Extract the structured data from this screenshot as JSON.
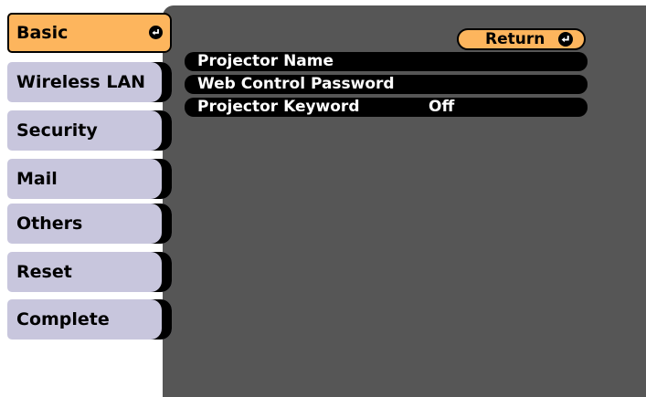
{
  "sidebar": {
    "items": [
      {
        "label": "Basic"
      },
      {
        "label": "Wireless LAN"
      },
      {
        "label": "Security"
      },
      {
        "label": "Mail"
      },
      {
        "label": "Others"
      },
      {
        "label": "Reset"
      },
      {
        "label": "Complete"
      }
    ],
    "active_index": 0,
    "active_icon": "enter-icon"
  },
  "main": {
    "return_label": "Return",
    "return_icon": "enter-icon",
    "rows": [
      {
        "label": "Projector Name",
        "value": ""
      },
      {
        "label": "Web Control Password",
        "value": ""
      },
      {
        "label": "Projector Keyword",
        "value": "Off"
      }
    ]
  },
  "colors": {
    "panel": "#565656",
    "tab": "#c8c6dd",
    "active": "#fdb55d",
    "row": "#000000",
    "text_light": "#ffffff"
  }
}
